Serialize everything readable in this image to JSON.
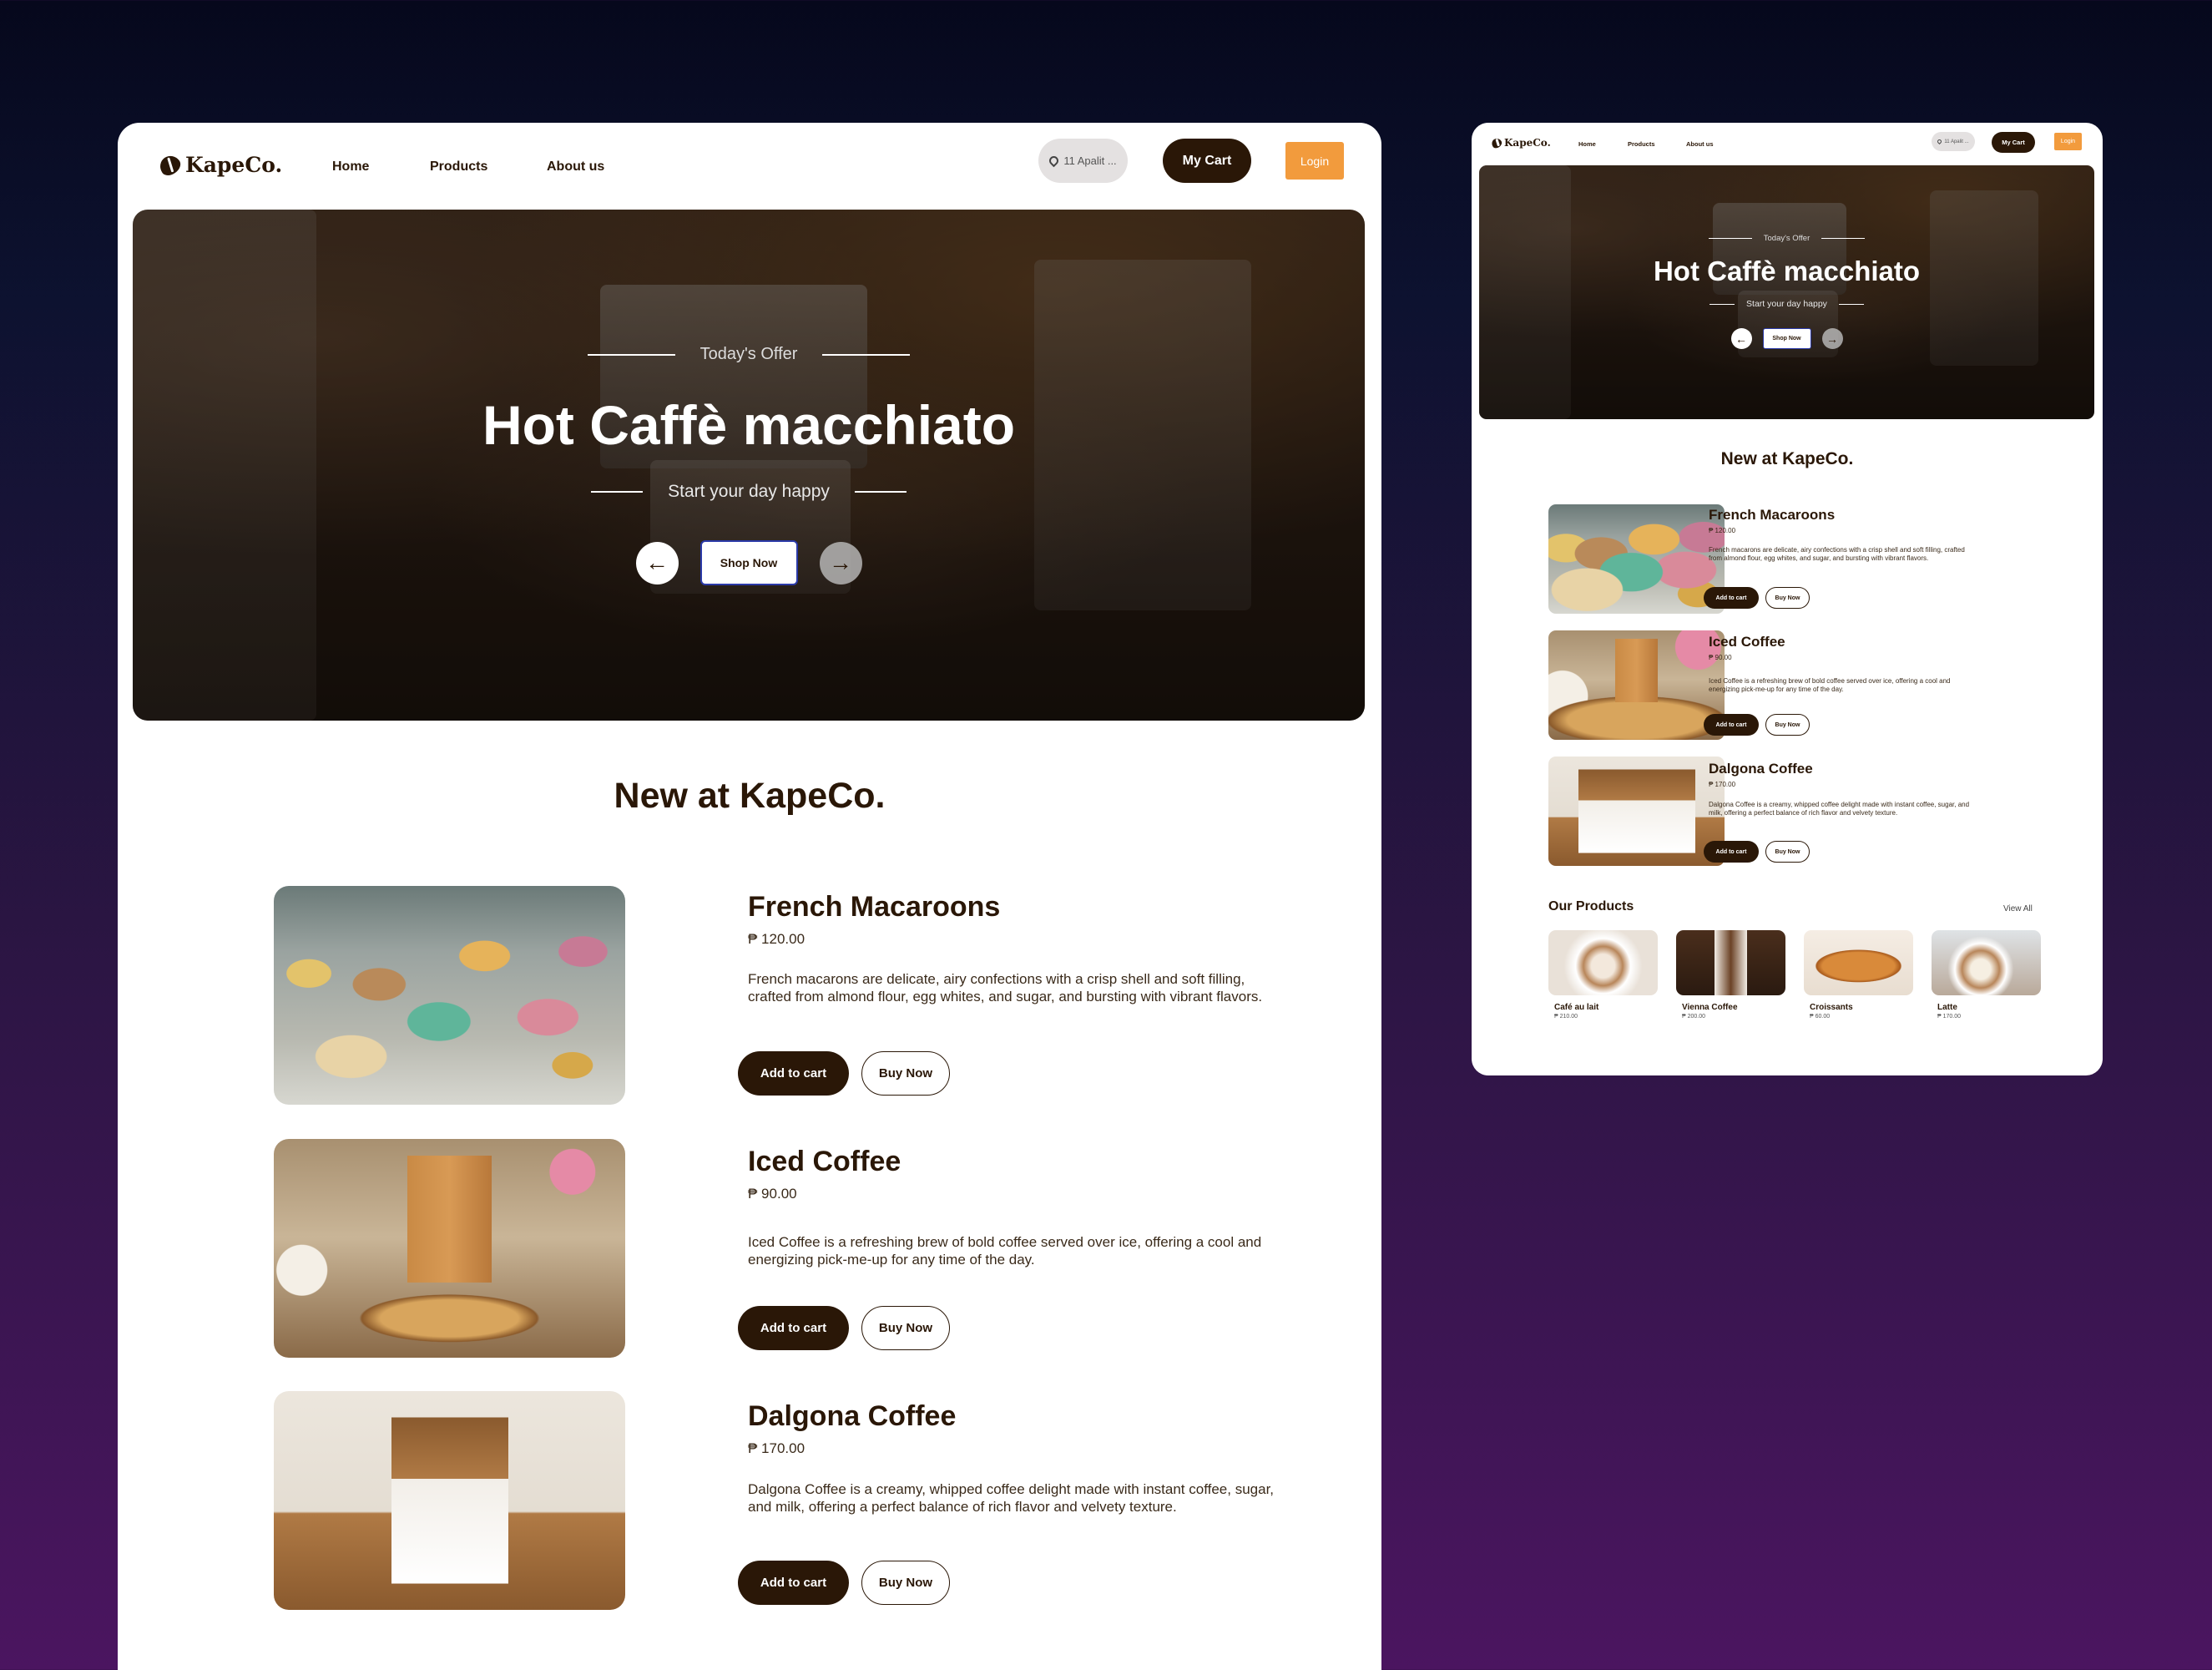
{
  "brand": {
    "name": "KapeCo."
  },
  "nav": {
    "home": "Home",
    "products": "Products",
    "about": "About us"
  },
  "location": {
    "short": "11 Apalit ...",
    "short_mini": "11 Apalit ..."
  },
  "header": {
    "cart": "My Cart",
    "login": "Login"
  },
  "hero": {
    "eyebrow": "Today's Offer",
    "title": "Hot Caffè macchiato",
    "subtitle": "Start your day happy",
    "cta": "Shop Now",
    "prev_icon": "arrow-left-icon",
    "next_icon": "arrow-right-icon"
  },
  "new_section": {
    "title": "New at KapeCo."
  },
  "products": [
    {
      "name": "French Macaroons",
      "price": "₱ 120.00",
      "description": "French macarons are delicate, airy confections with a crisp shell and soft filling, crafted from almond flour, egg whites, and sugar, and bursting with vibrant flavors.",
      "add": "Add to cart",
      "buy": "Buy Now"
    },
    {
      "name": "Iced Coffee",
      "price": "₱ 90.00",
      "description": "Iced Coffee is a refreshing brew of bold coffee served over ice, offering a cool and energizing pick-me-up for any time of the day.",
      "add": "Add to cart",
      "buy": "Buy Now"
    },
    {
      "name": "Dalgona Coffee",
      "price": "₱ 170.00",
      "description": "Dalgona Coffee is a creamy, whipped coffee delight made with instant coffee, sugar, and milk, offering a perfect balance of rich flavor and velvety texture.",
      "add": "Add to cart",
      "buy": "Buy Now"
    }
  ],
  "our_products": {
    "title": "Our Products",
    "view_all": "View All",
    "items": [
      {
        "name": "Café au lait",
        "price": "₱ 210.00"
      },
      {
        "name": "Vienna Coffee",
        "price": "₱ 200.00"
      },
      {
        "name": "Croissants",
        "price": "₱ 60.00"
      },
      {
        "name": "Latte",
        "price": "₱ 170.00"
      }
    ]
  },
  "colors": {
    "brand_dark": "#2a1707",
    "login_orange": "#f29b3d",
    "background_top": "#06081c",
    "background_bottom": "#4b1560"
  }
}
